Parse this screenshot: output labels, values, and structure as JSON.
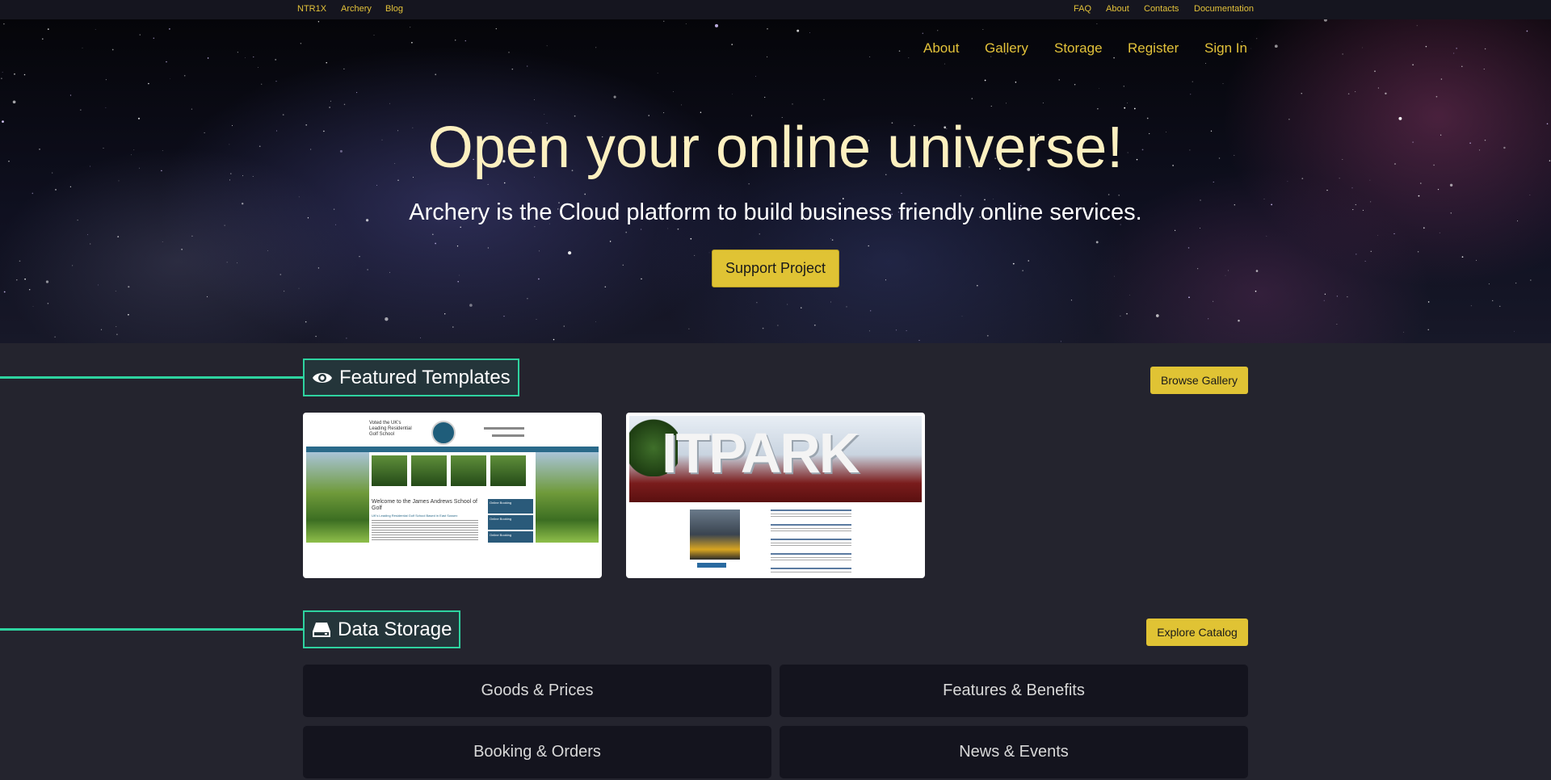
{
  "topbar": {
    "left_links": [
      "NTR1X",
      "Archery",
      "Blog"
    ],
    "right_links": [
      "FAQ",
      "About",
      "Contacts",
      "Documentation"
    ]
  },
  "nav": {
    "links": [
      "About",
      "Gallery",
      "Storage",
      "Register",
      "Sign In"
    ]
  },
  "hero": {
    "title": "Open your online universe!",
    "subtitle": "Archery is the Cloud platform to build business friendly online services.",
    "button_label": "Support Project"
  },
  "featured": {
    "title": "Featured Templates",
    "icon": "eye-icon",
    "button_label": "Browse Gallery",
    "thumbnails": [
      {
        "name": "golf-school-template",
        "heading": "Voted the UK's Leading Residential Golf School",
        "welcome": "Welcome to the James Andrews School of Golf",
        "tagline": "UK's Leading Residential Golf School Based in East Sussex",
        "booking_label": "Online Booking"
      },
      {
        "name": "it-park-template",
        "sign_text": "ITPARK"
      }
    ]
  },
  "storage": {
    "title": "Data Storage",
    "icon": "hdd-icon",
    "button_label": "Explore Catalog",
    "cards": [
      "Goods & Prices",
      "Features & Benefits",
      "Booking & Orders",
      "News & Events"
    ]
  },
  "colors": {
    "accent_yellow": "#e0c334",
    "accent_green": "#2ed3a0",
    "page_bg": "#24242e",
    "card_bg": "#14141e"
  }
}
